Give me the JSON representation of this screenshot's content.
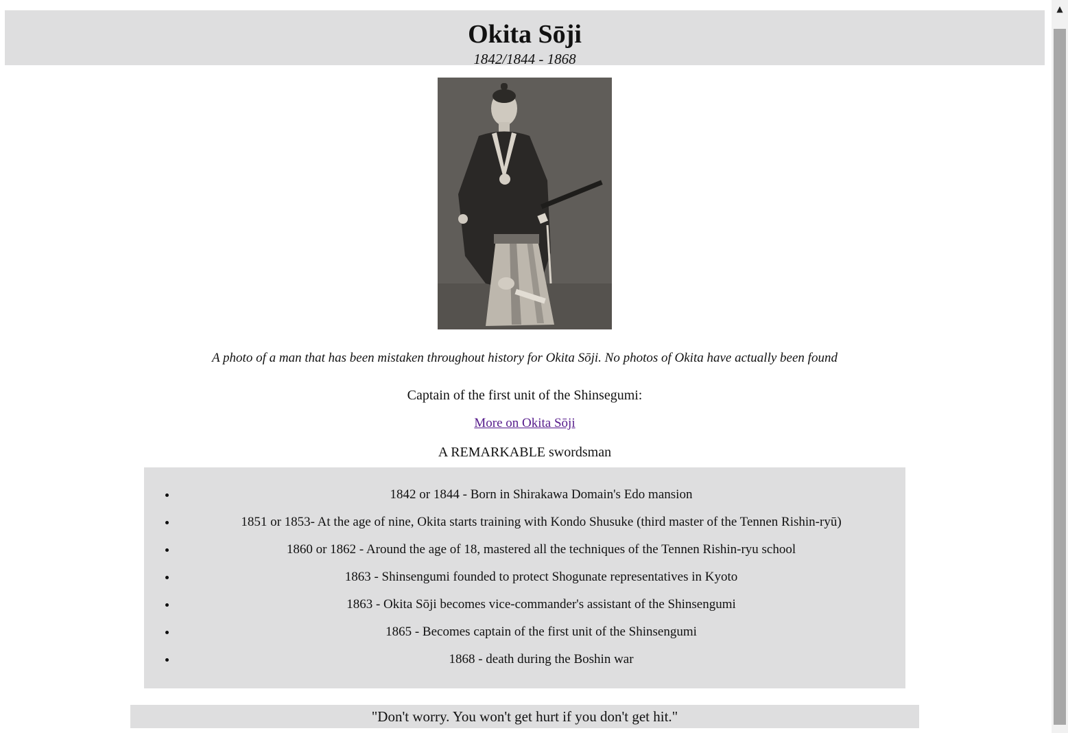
{
  "header": {
    "title": "Okita Sōji",
    "dates": "1842/1844 - 1868"
  },
  "photo": {
    "icon": "portrait-photo",
    "caption": "A photo of a man that has been mistaken throughout history for Okita Sōji. No photos of Okita have actually been found"
  },
  "role": "Captain of the first unit of the Shinsegumi:",
  "more_link": "More on Okita Sōji",
  "remark": "A REMARKABLE swordsman",
  "timeline": [
    "1842 or 1844 - Born in Shirakawa Domain's Edo mansion",
    "1851 or 1853- At the age of nine, Okita starts training with Kondo Shusuke (third master of the Tennen Rishin-ryū)",
    "1860 or 1862 - Around the age of 18, mastered all the techniques of the Tennen Rishin-ryu school",
    "1863 - Shinsengumi founded to protect Shogunate representatives in Kyoto",
    "1863 - Okita Sōji becomes vice-commander's assistant of the Shinsengumi",
    "1865 - Becomes captain of the first unit of the Shinsengumi",
    "1868 - death during the Boshin war"
  ],
  "quote": "\"Don't worry. You won't get hurt if you don't get hit.\"",
  "scrollbar": {
    "up_icon": "▲"
  },
  "colors": {
    "panel_bg": "#dededf",
    "link_visited": "#551a8b"
  }
}
